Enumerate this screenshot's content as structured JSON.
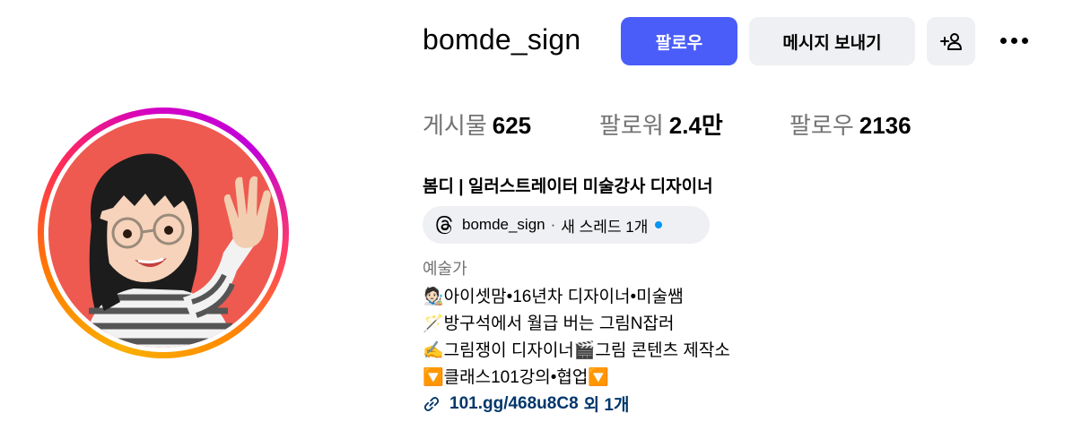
{
  "profile": {
    "username": "bomde_sign",
    "display_name": "봄디 | 일러스트레이터 미술강사 디자이너",
    "category": "예술가"
  },
  "actions": {
    "follow_label": "팔로우",
    "message_label": "메시지 보내기",
    "add_person_icon": "add-person-icon",
    "more_icon": "more-options-icon"
  },
  "stats": [
    {
      "label": "게시물",
      "value": "625"
    },
    {
      "label": "팔로워",
      "value": "2.4만"
    },
    {
      "label": "팔로우",
      "value": "2136"
    }
  ],
  "threads": {
    "icon": "threads-icon",
    "handle": "bomde_sign",
    "separator": "·",
    "status": "새 스레드 1개"
  },
  "bio": [
    "🧑🏻‍🎨아이셋맘•16년차 디자이너•미술쌤",
    "🪄방구석에서 월급 버는 그림N잡러",
    "✍️그림쟁이 디자이너🎬그림 콘텐츠 제작소",
    "🔽클래스101강의•협업🔽"
  ],
  "link": {
    "icon": "link-icon",
    "text": "101.gg/468u8C8",
    "suffix": "외 1개"
  },
  "colors": {
    "follow_button": "#4a5df9",
    "secondary_button": "#eff0f3",
    "link_text": "#00376b",
    "muted_text": "#737373",
    "notification_dot": "#0095f6"
  }
}
